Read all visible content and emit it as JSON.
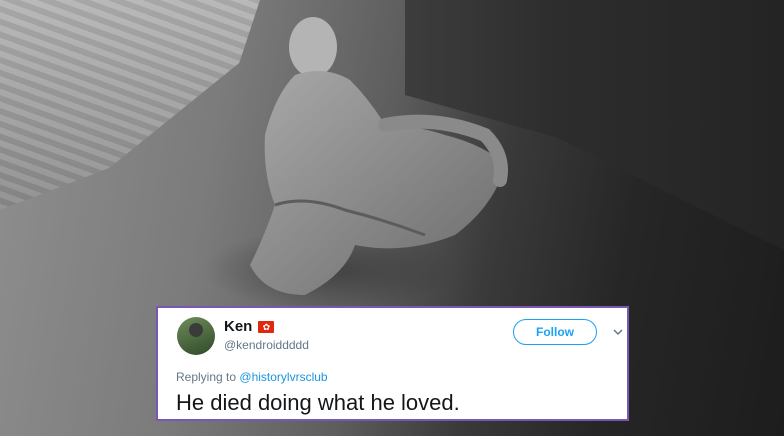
{
  "photo": {
    "subject": "plaster-cast-figure-icon"
  },
  "tweet": {
    "name": "Ken",
    "flag_icon": "hong-kong-flag-icon",
    "handle": "@kendroiddddd",
    "follow_label": "Follow",
    "reply_prefix": "Replying to",
    "reply_mention": "@historylvrsclub",
    "text": "He died doing what he loved.",
    "border_color": "#7a57b5",
    "accent_color": "#1da1f2"
  }
}
